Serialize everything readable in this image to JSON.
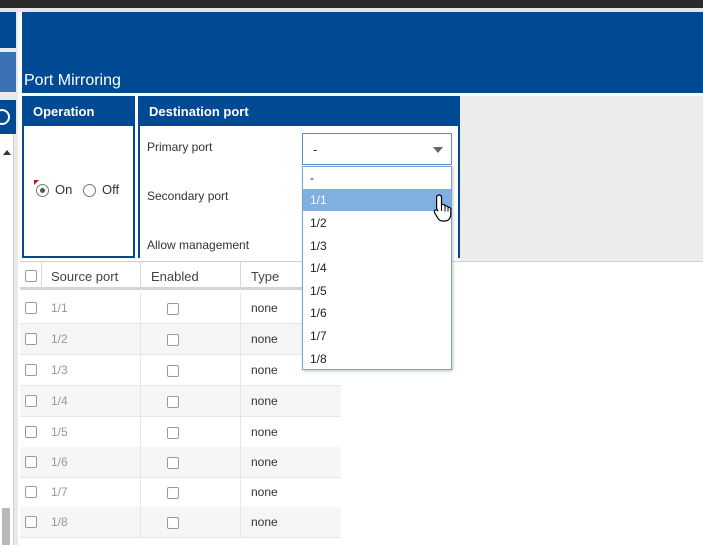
{
  "header": {
    "title": "Port Mirroring"
  },
  "operation": {
    "title": "Operation",
    "on_label": "On",
    "off_label": "Off",
    "selected": "On"
  },
  "destination": {
    "title": "Destination port",
    "primary_label": "Primary port",
    "secondary_label": "Secondary port",
    "allow_label": "Allow management",
    "primary_value": "-",
    "options": [
      "-",
      "1/1",
      "1/2",
      "1/3",
      "1/4",
      "1/5",
      "1/6",
      "1/7",
      "1/8"
    ],
    "highlighted_option": "1/1"
  },
  "table": {
    "headers": {
      "source": "Source port",
      "enabled": "Enabled",
      "type": "Type"
    },
    "rows": [
      {
        "port": "1/1",
        "type": "none"
      },
      {
        "port": "1/2",
        "type": "none"
      },
      {
        "port": "1/3",
        "type": "none"
      },
      {
        "port": "1/4",
        "type": "none"
      },
      {
        "port": "1/5",
        "type": "none"
      },
      {
        "port": "1/6",
        "type": "none"
      },
      {
        "port": "1/7",
        "type": "none"
      },
      {
        "port": "1/8",
        "type": "none"
      }
    ]
  },
  "colors": {
    "brand": "#004a93",
    "highlight": "#80b0e0"
  }
}
